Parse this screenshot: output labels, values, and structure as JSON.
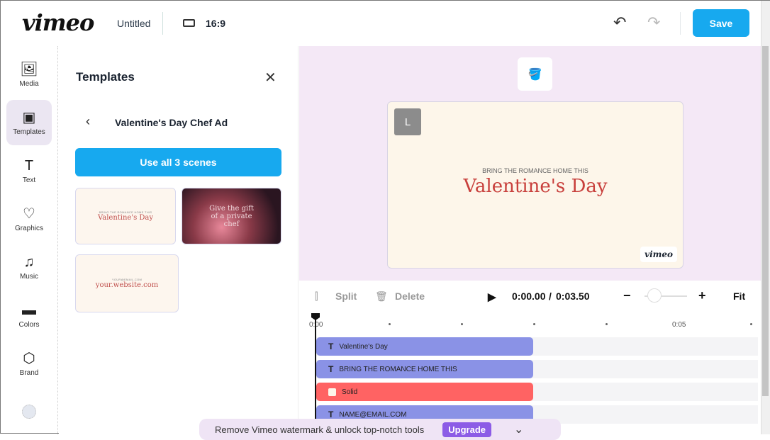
{
  "header": {
    "logo": "vimeo",
    "title": "Untitled",
    "aspect_ratio": "16:9",
    "save_label": "Save"
  },
  "sidebar": {
    "items": [
      {
        "label": "Media",
        "icon": "🖼"
      },
      {
        "label": "Templates",
        "icon": "▣"
      },
      {
        "label": "Text",
        "icon": "T"
      },
      {
        "label": "Graphics",
        "icon": "♡"
      },
      {
        "label": "Music",
        "icon": "♫"
      },
      {
        "label": "Colors",
        "icon": "▬"
      },
      {
        "label": "Brand",
        "icon": "⬡"
      }
    ]
  },
  "panel": {
    "title": "Templates",
    "template_name": "Valentine's Day Chef Ad",
    "use_all_label": "Use all 3 scenes",
    "thumbs": [
      {
        "small": "BRING THE ROMANCE HOME THIS",
        "big": "Valentine's Day"
      },
      {
        "big": "Give the gift of a private chef"
      },
      {
        "small": "YOUR@EMAIL.COM",
        "big": "your.website.com"
      }
    ]
  },
  "stage": {
    "subtitle": "BRING THE ROMANCE HOME THIS",
    "title": "Valentine's Day",
    "watermark": "vimeo",
    "brand_badge": "L"
  },
  "timeline": {
    "split_label": "Split",
    "delete_label": "Delete",
    "current_time": "0:00.00",
    "separator": "/",
    "duration": "0:03.50",
    "fit_label": "Fit",
    "zoom_level": 0.1,
    "ruler": [
      "0:00",
      "0:05"
    ],
    "tracks": [
      {
        "type": "text",
        "label": "Valentine's Day"
      },
      {
        "type": "text",
        "label": "BRING THE ROMANCE HOME THIS"
      },
      {
        "type": "solid",
        "label": "Solid"
      },
      {
        "type": "text",
        "label": "NAME@EMAIL.COM"
      }
    ]
  },
  "banner": {
    "text": "Remove Vimeo watermark & unlock top-notch tools",
    "upgrade_label": "Upgrade"
  },
  "colors": {
    "accent": "#17a9ef",
    "text_clip": "#8a92e6",
    "solid_clip": "#ff6363",
    "upgrade": "#8c5ce6"
  }
}
